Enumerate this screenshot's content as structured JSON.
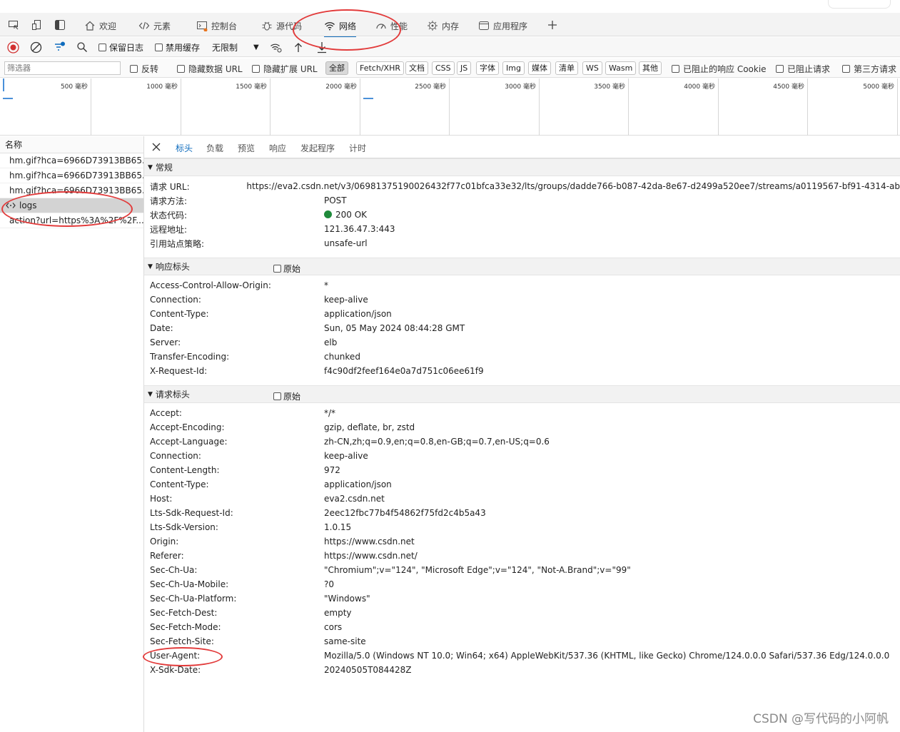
{
  "tabs": [
    {
      "label": "欢迎",
      "icon": "home-icon"
    },
    {
      "label": "元素",
      "icon": "code-icon"
    },
    {
      "label": "控制台",
      "icon": "console-icon"
    },
    {
      "label": "源代码",
      "icon": "bug-icon"
    },
    {
      "label": "网络",
      "icon": "wifi-icon",
      "active": true
    },
    {
      "label": "性能",
      "icon": "gauge-icon"
    },
    {
      "label": "内存",
      "icon": "memory-icon"
    },
    {
      "label": "应用程序",
      "icon": "app-icon"
    }
  ],
  "toolbar": {
    "preserve_log": "保留日志",
    "disable_cache": "禁用缓存",
    "throttle": "无限制"
  },
  "filter": {
    "placeholder": "筛选器",
    "invert": "反转",
    "hide_data_url": "隐藏数据 URL",
    "hide_ext_url": "隐藏扩展 URL",
    "chips": [
      "全部",
      "Fetch/XHR",
      "文档",
      "CSS",
      "JS",
      "字体",
      "Img",
      "媒体",
      "清单",
      "WS",
      "Wasm",
      "其他"
    ],
    "blocked_cookies": "已阻止的响应 Cookie",
    "blocked_requests": "已阻止请求",
    "third_party": "第三方请求"
  },
  "timeline": {
    "ticks": [
      "500 毫秒",
      "1000 毫秒",
      "1500 毫秒",
      "2000 毫秒",
      "2500 毫秒",
      "3000 毫秒",
      "3500 毫秒",
      "4000 毫秒",
      "4500 毫秒",
      "5000 毫秒"
    ]
  },
  "requests": {
    "header": "名称",
    "items": [
      {
        "name": "hm.gif?hca=6966D73913BB65...",
        "icon": "document-icon"
      },
      {
        "name": "hm.gif?hca=6966D73913BB65...",
        "icon": "document-icon"
      },
      {
        "name": "hm.gif?hca=6966D73913BB65...",
        "icon": "document-icon"
      },
      {
        "name": "logs",
        "icon": "xhr-icon",
        "selected": true
      },
      {
        "name": "action?url=https%3A%2F%2F...",
        "icon": "document-icon"
      }
    ]
  },
  "detail_tabs": [
    "标头",
    "负载",
    "预览",
    "响应",
    "发起程序",
    "计时"
  ],
  "general": {
    "title": "常规",
    "rows": [
      {
        "k": "请求 URL:",
        "v": "https://eva2.csdn.net/v3/06981375190026432f77c01bfca33e32/lts/groups/dadde766-b087-42da-8e67-d2499a520ee7/streams/a0119567-bf91-4314-ab"
      },
      {
        "k": "请求方法:",
        "v": "POST"
      },
      {
        "k": "状态代码:",
        "v": "200 OK",
        "status": true
      },
      {
        "k": "远程地址:",
        "v": "121.36.47.3:443"
      },
      {
        "k": "引用站点策略:",
        "v": "unsafe-url"
      }
    ]
  },
  "response_headers": {
    "title": "响应标头",
    "raw": "原始",
    "rows": [
      {
        "k": "Access-Control-Allow-Origin:",
        "v": "*"
      },
      {
        "k": "Connection:",
        "v": "keep-alive"
      },
      {
        "k": "Content-Type:",
        "v": "application/json"
      },
      {
        "k": "Date:",
        "v": "Sun, 05 May 2024 08:44:28 GMT"
      },
      {
        "k": "Server:",
        "v": "elb"
      },
      {
        "k": "Transfer-Encoding:",
        "v": "chunked"
      },
      {
        "k": "X-Request-Id:",
        "v": "f4c90df2feef164e0a7d751c06ee61f9"
      }
    ]
  },
  "request_headers": {
    "title": "请求标头",
    "raw": "原始",
    "rows": [
      {
        "k": "Accept:",
        "v": "*/*"
      },
      {
        "k": "Accept-Encoding:",
        "v": "gzip, deflate, br, zstd"
      },
      {
        "k": "Accept-Language:",
        "v": "zh-CN,zh;q=0.9,en;q=0.8,en-GB;q=0.7,en-US;q=0.6"
      },
      {
        "k": "Connection:",
        "v": "keep-alive"
      },
      {
        "k": "Content-Length:",
        "v": "972"
      },
      {
        "k": "Content-Type:",
        "v": "application/json"
      },
      {
        "k": "Host:",
        "v": "eva2.csdn.net"
      },
      {
        "k": "Lts-Sdk-Request-Id:",
        "v": "2eec12fbc77b4f54862f75fd2c4b5a43"
      },
      {
        "k": "Lts-Sdk-Version:",
        "v": "1.0.15"
      },
      {
        "k": "Origin:",
        "v": "https://www.csdn.net"
      },
      {
        "k": "Referer:",
        "v": "https://www.csdn.net/"
      },
      {
        "k": "Sec-Ch-Ua:",
        "v": "\"Chromium\";v=\"124\", \"Microsoft Edge\";v=\"124\", \"Not-A.Brand\";v=\"99\""
      },
      {
        "k": "Sec-Ch-Ua-Mobile:",
        "v": "?0"
      },
      {
        "k": "Sec-Ch-Ua-Platform:",
        "v": "\"Windows\""
      },
      {
        "k": "Sec-Fetch-Dest:",
        "v": "empty"
      },
      {
        "k": "Sec-Fetch-Mode:",
        "v": "cors"
      },
      {
        "k": "Sec-Fetch-Site:",
        "v": "same-site"
      },
      {
        "k": "User-Agent:",
        "v": "Mozilla/5.0 (Windows NT 10.0; Win64; x64) AppleWebKit/537.36 (KHTML, like Gecko) Chrome/124.0.0.0 Safari/537.36 Edg/124.0.0.0"
      },
      {
        "k": "X-Sdk-Date:",
        "v": "20240505T084428Z"
      }
    ]
  },
  "watermark": "CSDN @写代码的小阿帆",
  "colors": {
    "accent": "#0f6cbd",
    "annotation": "#e23b3b",
    "status_ok": "#1f8a3b"
  }
}
